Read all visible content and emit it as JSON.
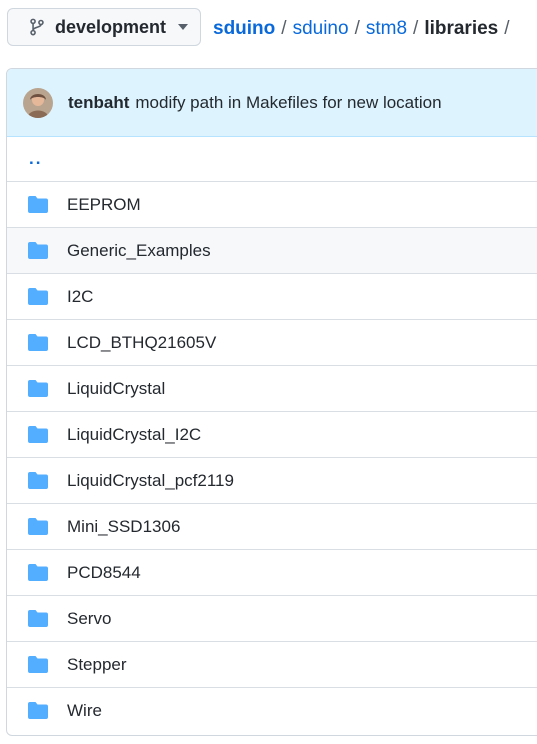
{
  "branch": {
    "name": "development",
    "icon": "git-branch-icon",
    "caret_icon": "caret-down-icon"
  },
  "breadcrumb": {
    "root": "sduino",
    "parts": [
      "sduino",
      "stm8"
    ],
    "current": "libraries",
    "separator": "/"
  },
  "commit": {
    "author": "tenbaht",
    "message": "modify path in Makefiles for new location",
    "avatar_icon": "avatar"
  },
  "files": {
    "parent_link": "..",
    "items": [
      {
        "name": "EEPROM",
        "type": "folder"
      },
      {
        "name": "Generic_Examples",
        "type": "folder"
      },
      {
        "name": "I2C",
        "type": "folder"
      },
      {
        "name": "LCD_BTHQ21605V",
        "type": "folder"
      },
      {
        "name": "LiquidCrystal",
        "type": "folder"
      },
      {
        "name": "LiquidCrystal_I2C",
        "type": "folder"
      },
      {
        "name": "LiquidCrystal_pcf2119",
        "type": "folder"
      },
      {
        "name": "Mini_SSD1306",
        "type": "folder"
      },
      {
        "name": "PCD8544",
        "type": "folder"
      },
      {
        "name": "Servo",
        "type": "folder"
      },
      {
        "name": "Stepper",
        "type": "folder"
      },
      {
        "name": "Wire",
        "type": "folder"
      }
    ]
  },
  "colors": {
    "link": "#0969da",
    "folder": "#54aeff",
    "commit_bar_bg": "#ddf4ff",
    "hover_row": "#f6f8fa"
  }
}
